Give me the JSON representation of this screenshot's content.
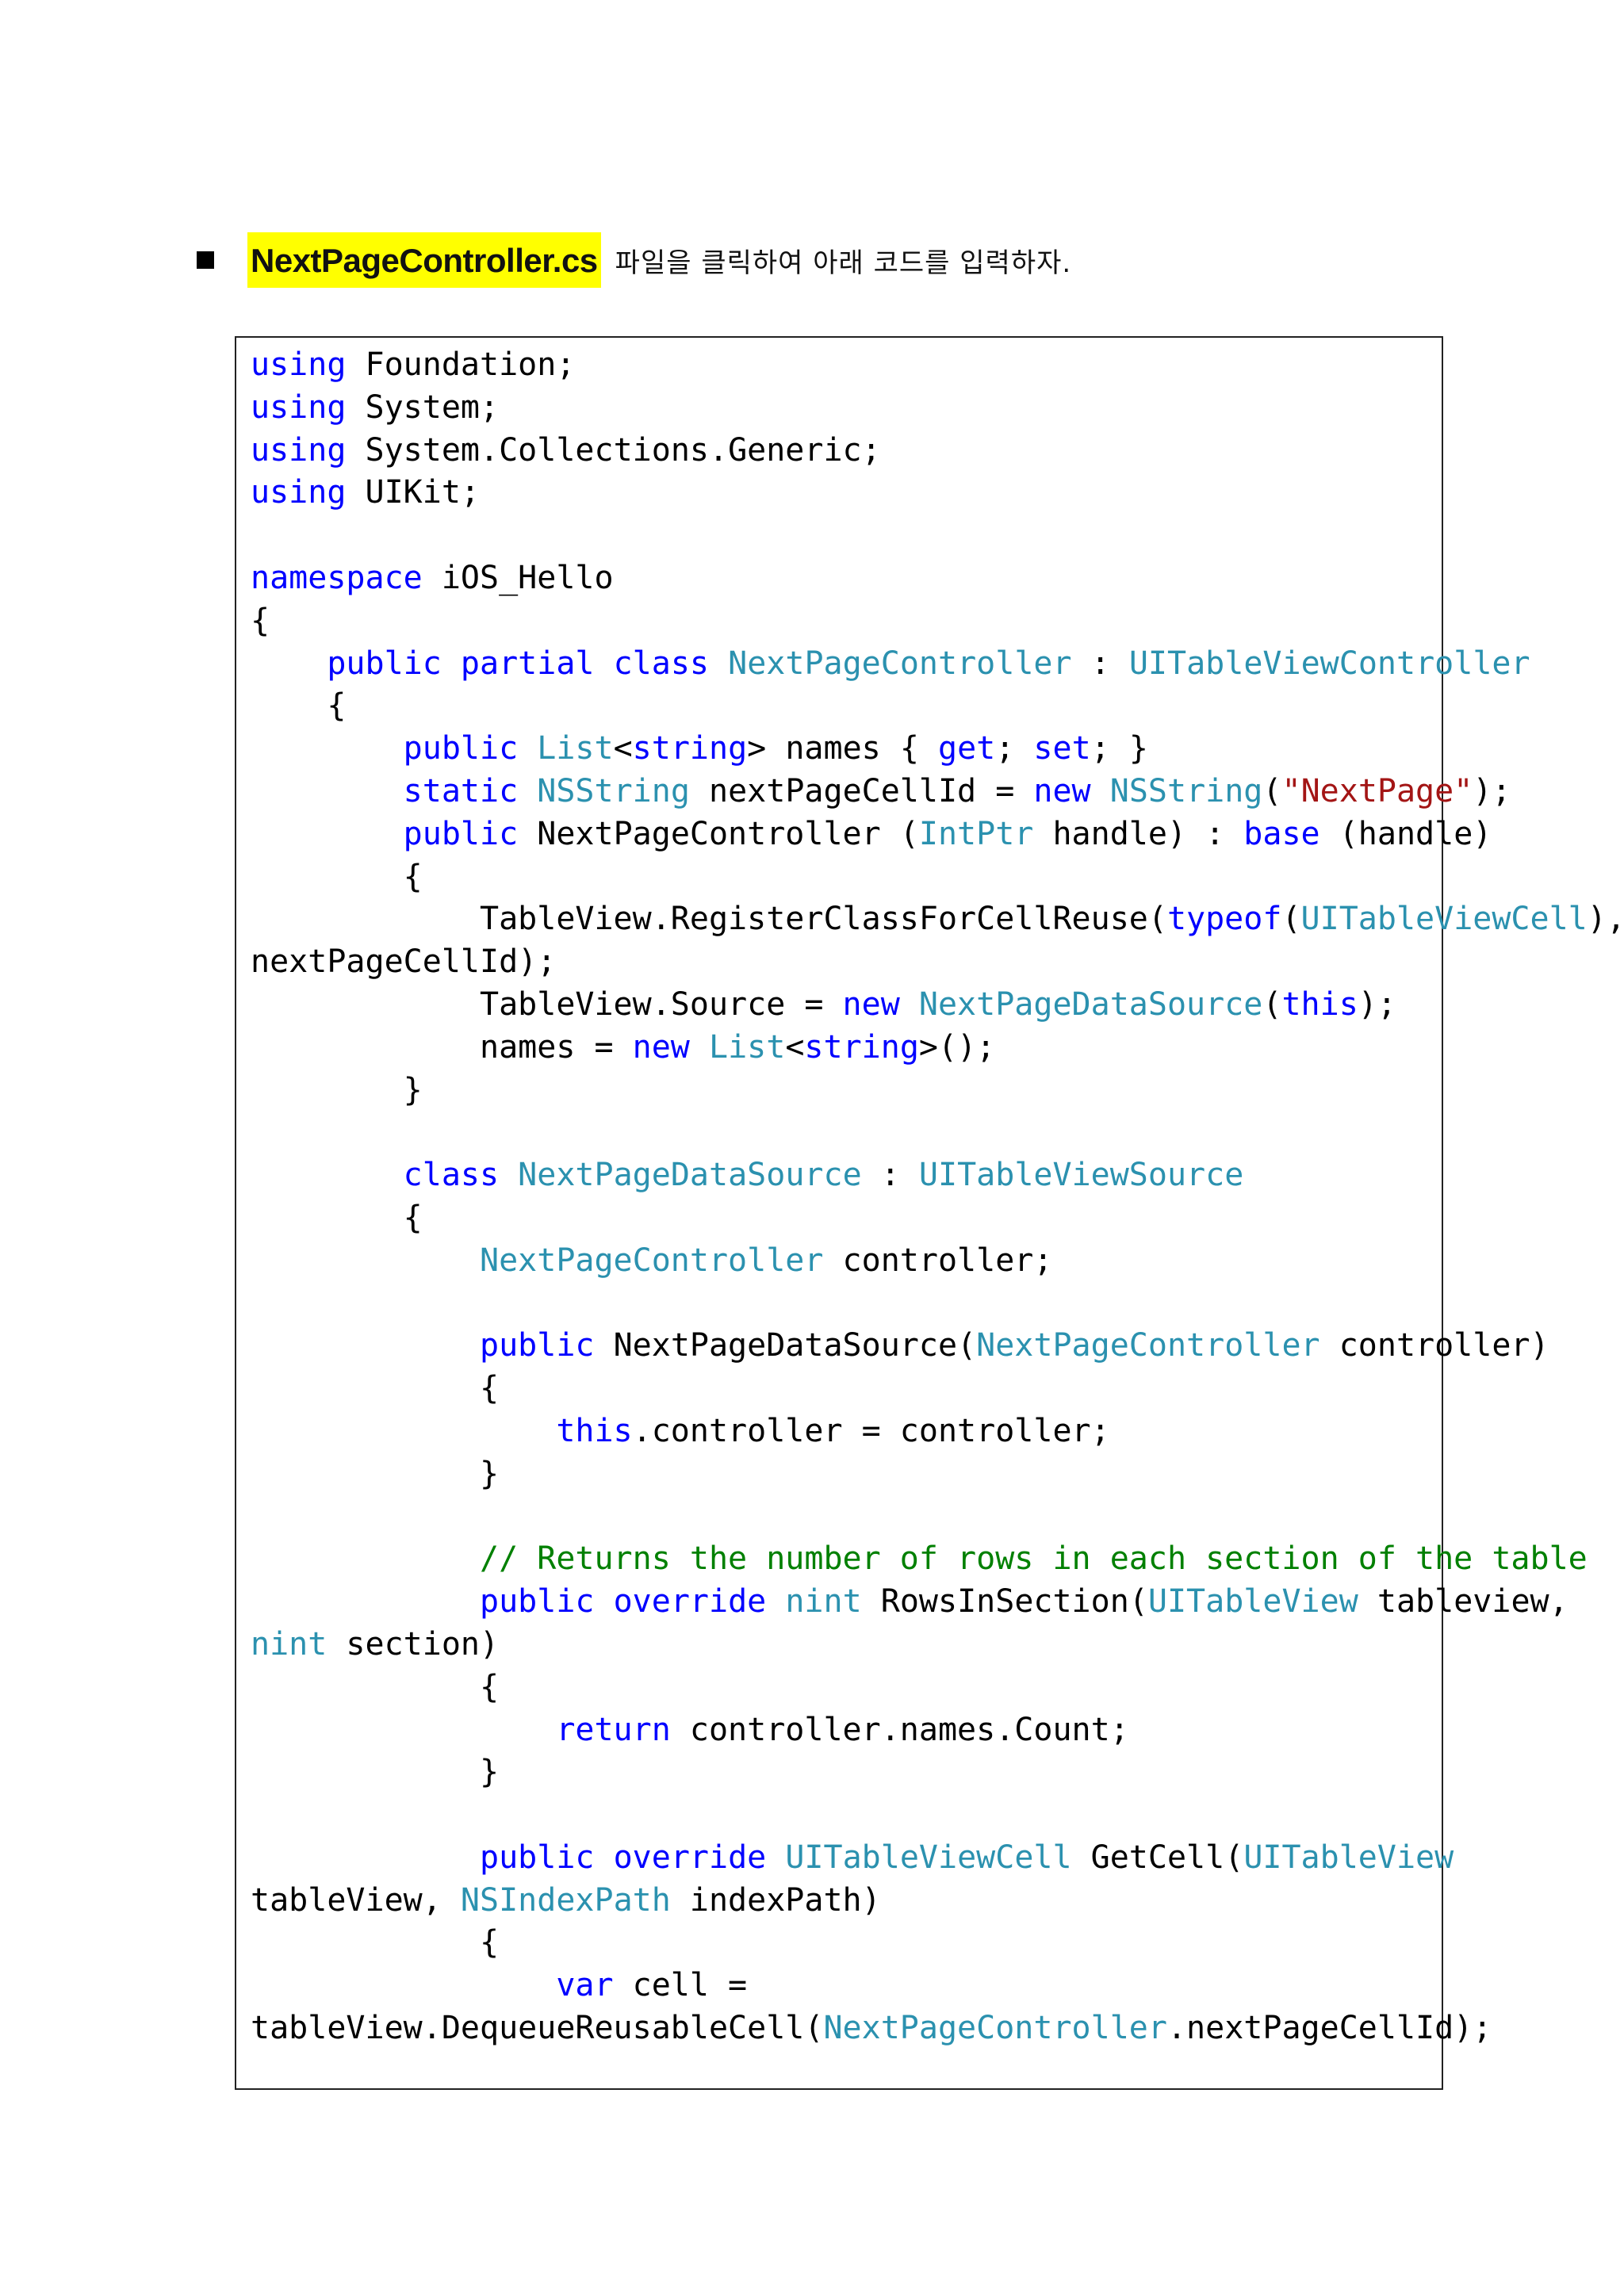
{
  "instruction": {
    "filename": "NextPageController.cs",
    "text": "파일을 클릭하여 아래 코드를 입력하자."
  },
  "code_lines": [
    [
      {
        "t": "kw",
        "v": "using"
      },
      {
        "t": "p",
        "v": " Foundation;"
      }
    ],
    [
      {
        "t": "kw",
        "v": "using"
      },
      {
        "t": "p",
        "v": " System;"
      }
    ],
    [
      {
        "t": "kw",
        "v": "using"
      },
      {
        "t": "p",
        "v": " System.Collections.Generic;"
      }
    ],
    [
      {
        "t": "kw",
        "v": "using"
      },
      {
        "t": "p",
        "v": " UIKit;"
      }
    ],
    [],
    [
      {
        "t": "kw",
        "v": "namespace"
      },
      {
        "t": "p",
        "v": " iOS_Hello"
      }
    ],
    [
      {
        "t": "p",
        "v": "{"
      }
    ],
    [
      {
        "t": "p",
        "v": "    "
      },
      {
        "t": "kw",
        "v": "public"
      },
      {
        "t": "p",
        "v": " "
      },
      {
        "t": "kw",
        "v": "partial"
      },
      {
        "t": "p",
        "v": " "
      },
      {
        "t": "kw",
        "v": "class"
      },
      {
        "t": "p",
        "v": " "
      },
      {
        "t": "ty",
        "v": "NextPageController"
      },
      {
        "t": "p",
        "v": " : "
      },
      {
        "t": "ty",
        "v": "UITableViewController"
      }
    ],
    [
      {
        "t": "p",
        "v": "    {"
      }
    ],
    [
      {
        "t": "p",
        "v": "        "
      },
      {
        "t": "kw",
        "v": "public"
      },
      {
        "t": "p",
        "v": " "
      },
      {
        "t": "ty",
        "v": "List"
      },
      {
        "t": "p",
        "v": "<"
      },
      {
        "t": "kw",
        "v": "string"
      },
      {
        "t": "p",
        "v": "> names { "
      },
      {
        "t": "kw",
        "v": "get"
      },
      {
        "t": "p",
        "v": "; "
      },
      {
        "t": "kw",
        "v": "set"
      },
      {
        "t": "p",
        "v": "; }"
      }
    ],
    [
      {
        "t": "p",
        "v": "        "
      },
      {
        "t": "kw",
        "v": "static"
      },
      {
        "t": "p",
        "v": " "
      },
      {
        "t": "ty",
        "v": "NSString"
      },
      {
        "t": "p",
        "v": " nextPageCellId = "
      },
      {
        "t": "kw",
        "v": "new"
      },
      {
        "t": "p",
        "v": " "
      },
      {
        "t": "ty",
        "v": "NSString"
      },
      {
        "t": "p",
        "v": "("
      },
      {
        "t": "st",
        "v": "\"NextPage\""
      },
      {
        "t": "p",
        "v": ");"
      }
    ],
    [
      {
        "t": "p",
        "v": "        "
      },
      {
        "t": "kw",
        "v": "public"
      },
      {
        "t": "p",
        "v": " NextPageController ("
      },
      {
        "t": "ty",
        "v": "IntPtr"
      },
      {
        "t": "p",
        "v": " handle) : "
      },
      {
        "t": "kw",
        "v": "base"
      },
      {
        "t": "p",
        "v": " (handle)"
      }
    ],
    [
      {
        "t": "p",
        "v": "        {"
      }
    ],
    [
      {
        "t": "p",
        "v": "            TableView.RegisterClassForCellReuse("
      },
      {
        "t": "kw",
        "v": "typeof"
      },
      {
        "t": "p",
        "v": "("
      },
      {
        "t": "ty",
        "v": "UITableViewCell"
      },
      {
        "t": "p",
        "v": "),"
      }
    ],
    [
      {
        "t": "p",
        "v": "nextPageCellId);"
      }
    ],
    [
      {
        "t": "p",
        "v": "            TableView.Source = "
      },
      {
        "t": "kw",
        "v": "new"
      },
      {
        "t": "p",
        "v": " "
      },
      {
        "t": "ty",
        "v": "NextPageDataSource"
      },
      {
        "t": "p",
        "v": "("
      },
      {
        "t": "kw",
        "v": "this"
      },
      {
        "t": "p",
        "v": ");"
      }
    ],
    [
      {
        "t": "p",
        "v": "            names = "
      },
      {
        "t": "kw",
        "v": "new"
      },
      {
        "t": "p",
        "v": " "
      },
      {
        "t": "ty",
        "v": "List"
      },
      {
        "t": "p",
        "v": "<"
      },
      {
        "t": "kw",
        "v": "string"
      },
      {
        "t": "p",
        "v": ">();"
      }
    ],
    [
      {
        "t": "p",
        "v": "        }"
      }
    ],
    [],
    [
      {
        "t": "p",
        "v": "        "
      },
      {
        "t": "kw",
        "v": "class"
      },
      {
        "t": "p",
        "v": " "
      },
      {
        "t": "ty",
        "v": "NextPageDataSource"
      },
      {
        "t": "p",
        "v": " : "
      },
      {
        "t": "ty",
        "v": "UITableViewSource"
      }
    ],
    [
      {
        "t": "p",
        "v": "        {"
      }
    ],
    [
      {
        "t": "p",
        "v": "            "
      },
      {
        "t": "ty",
        "v": "NextPageController"
      },
      {
        "t": "p",
        "v": " controller;"
      }
    ],
    [],
    [
      {
        "t": "p",
        "v": "            "
      },
      {
        "t": "kw",
        "v": "public"
      },
      {
        "t": "p",
        "v": " NextPageDataSource("
      },
      {
        "t": "ty",
        "v": "NextPageController"
      },
      {
        "t": "p",
        "v": " controller)"
      }
    ],
    [
      {
        "t": "p",
        "v": "            {"
      }
    ],
    [
      {
        "t": "p",
        "v": "                "
      },
      {
        "t": "kw",
        "v": "this"
      },
      {
        "t": "p",
        "v": ".controller = controller;"
      }
    ],
    [
      {
        "t": "p",
        "v": "            }"
      }
    ],
    [],
    [
      {
        "t": "p",
        "v": "            "
      },
      {
        "t": "cm",
        "v": "// Returns the number of rows in each section of the table"
      }
    ],
    [
      {
        "t": "p",
        "v": "            "
      },
      {
        "t": "kw",
        "v": "public"
      },
      {
        "t": "p",
        "v": " "
      },
      {
        "t": "kw",
        "v": "override"
      },
      {
        "t": "p",
        "v": " "
      },
      {
        "t": "ty",
        "v": "nint"
      },
      {
        "t": "p",
        "v": " RowsInSection("
      },
      {
        "t": "ty",
        "v": "UITableView"
      },
      {
        "t": "p",
        "v": " tableview,"
      }
    ],
    [
      {
        "t": "ty",
        "v": "nint"
      },
      {
        "t": "p",
        "v": " section)"
      }
    ],
    [
      {
        "t": "p",
        "v": "            {"
      }
    ],
    [
      {
        "t": "p",
        "v": "                "
      },
      {
        "t": "kw",
        "v": "return"
      },
      {
        "t": "p",
        "v": " controller.names.Count;"
      }
    ],
    [
      {
        "t": "p",
        "v": "            }"
      }
    ],
    [],
    [
      {
        "t": "p",
        "v": "            "
      },
      {
        "t": "kw",
        "v": "public"
      },
      {
        "t": "p",
        "v": " "
      },
      {
        "t": "kw",
        "v": "override"
      },
      {
        "t": "p",
        "v": " "
      },
      {
        "t": "ty",
        "v": "UITableViewCell"
      },
      {
        "t": "p",
        "v": " GetCell("
      },
      {
        "t": "ty",
        "v": "UITableView"
      }
    ],
    [
      {
        "t": "p",
        "v": "tableView, "
      },
      {
        "t": "ty",
        "v": "NSIndexPath"
      },
      {
        "t": "p",
        "v": " indexPath)"
      }
    ],
    [
      {
        "t": "p",
        "v": "            {"
      }
    ],
    [
      {
        "t": "p",
        "v": "                "
      },
      {
        "t": "kw",
        "v": "var"
      },
      {
        "t": "p",
        "v": " cell ="
      }
    ],
    [
      {
        "t": "p",
        "v": "tableView.DequeueReusableCell("
      },
      {
        "t": "ty",
        "v": "NextPageController"
      },
      {
        "t": "p",
        "v": ".nextPageCellId);"
      }
    ]
  ]
}
